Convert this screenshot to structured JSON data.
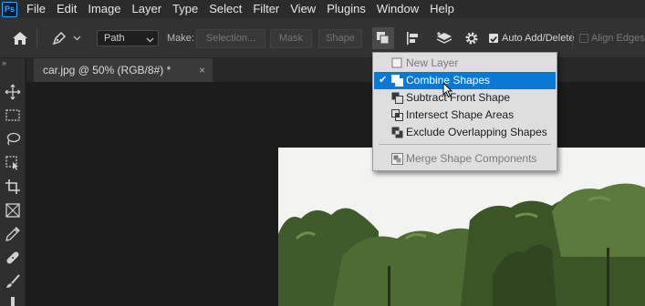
{
  "app": {
    "logo": "Ps"
  },
  "menu": [
    "File",
    "Edit",
    "Image",
    "Layer",
    "Type",
    "Select",
    "Filter",
    "View",
    "Plugins",
    "Window",
    "Help"
  ],
  "options": {
    "mode_select": "Path",
    "make_label": "Make:",
    "selection_button": "Selection...",
    "mask_button": "Mask",
    "shape_button": "Shape",
    "auto_add_delete_label": "Auto Add/Delete",
    "auto_add_delete_checked": true,
    "align_edges_label": "Align Edges",
    "align_edges_checked": false
  },
  "document": {
    "tab_title": "car.jpg @ 50% (RGB/8#) *",
    "close_glyph": "×"
  },
  "tools": [
    "move-tool-icon",
    "marquee-tool-icon",
    "lasso-tool-icon",
    "object-selection-tool-icon",
    "crop-tool-icon",
    "frame-tool-icon",
    "eyedropper-tool-icon",
    "healing-brush-tool-icon",
    "brush-tool-icon",
    "stamp-tool-icon"
  ],
  "dropdown": {
    "items": [
      {
        "label": "New Layer",
        "icon": "new-layer-icon",
        "disabled": true,
        "selected": false
      },
      {
        "label": "Combine Shapes",
        "icon": "combine-shapes-icon",
        "disabled": false,
        "selected": true,
        "check": "✔"
      },
      {
        "label": "Subtract Front Shape",
        "icon": "subtract-front-shape-icon",
        "disabled": false,
        "selected": false
      },
      {
        "label": "Intersect Shape Areas",
        "icon": "intersect-shape-areas-icon",
        "disabled": false,
        "selected": false
      },
      {
        "label": "Exclude Overlapping Shapes",
        "icon": "exclude-overlapping-shapes-icon",
        "disabled": false,
        "selected": false
      },
      {
        "label": "Merge Shape Components",
        "icon": "merge-shape-components-icon",
        "disabled": true,
        "selected": false
      }
    ]
  },
  "colors": {
    "menubar": "#2b2b2b",
    "optionsbar": "#323232",
    "selected_item": "#0a78d7",
    "dropdown_bg": "#dedede"
  }
}
